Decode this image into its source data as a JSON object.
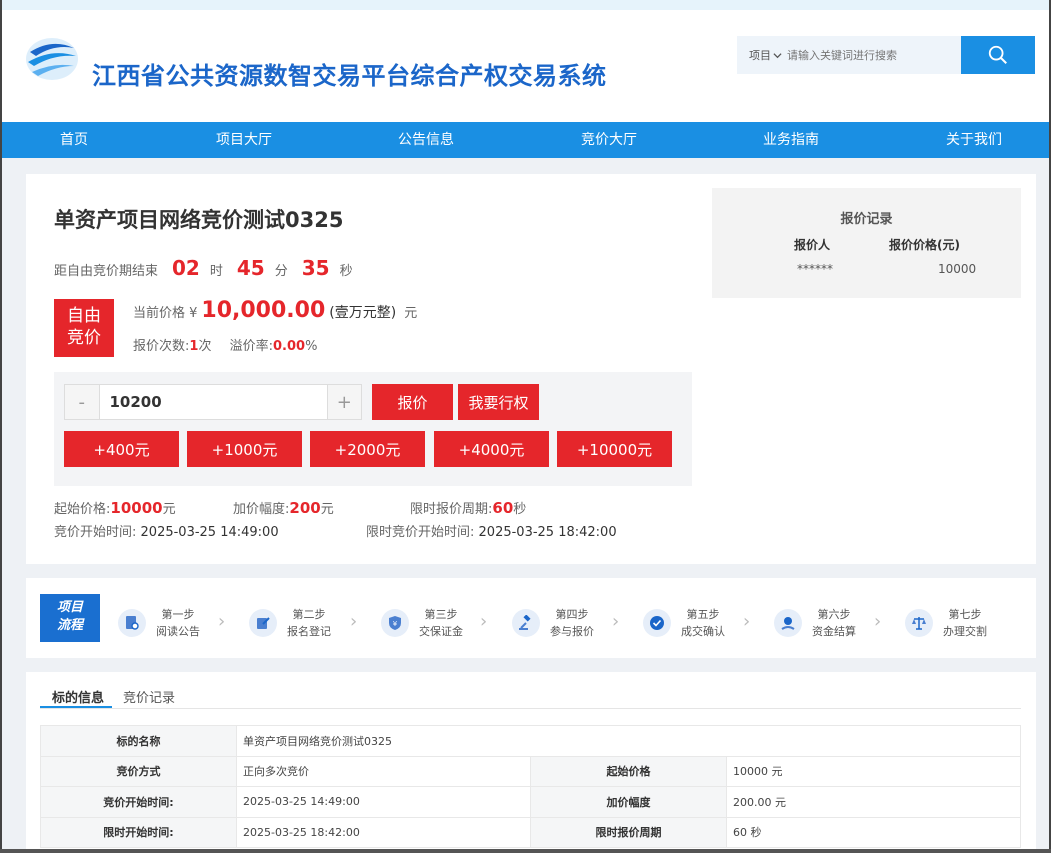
{
  "header": {
    "site_title": "江西省公共资源数智交易平台综合产权交易系统"
  },
  "search": {
    "category": "项目",
    "placeholder": "请输入关键词进行搜索"
  },
  "nav": [
    "首页",
    "项目大厅",
    "公告信息",
    "竞价大厅",
    "业务指南",
    "关于我们"
  ],
  "project": {
    "title": "单资产项目网络竞价测试0325",
    "countdown": {
      "label": "距自由竞价期结束",
      "hours": "02",
      "h_unit": "时",
      "minutes": "45",
      "m_unit": "分",
      "seconds": "35",
      "s_unit": "秒"
    },
    "mode_badge": [
      "自由",
      "竞价"
    ],
    "price": {
      "label": "当前价格 ¥",
      "value": "10,000.00",
      "words": "(壹万元整)",
      "unit": "元"
    },
    "bid_count_label": "报价次数:",
    "bid_count": "1",
    "bid_count_unit": "次",
    "premium_label": "溢价率:",
    "premium": "0.00",
    "premium_unit": "%"
  },
  "bid": {
    "minus": "-",
    "plus": "+",
    "amount": "10200",
    "submit": "报价",
    "exercise_right": "我要行权",
    "increments": [
      "+400元",
      "+1000元",
      "+2000元",
      "+4000元",
      "+10000元"
    ]
  },
  "terms": {
    "start_price_label": "起始价格:",
    "start_price": "10000",
    "start_price_unit": "元",
    "increment_label": "加价幅度:",
    "increment": "200",
    "increment_unit": "元",
    "limit_cycle_label": "限时报价周期:",
    "limit_cycle": "60",
    "limit_cycle_unit": "秒",
    "start_time_label": "竞价开始时间:",
    "start_time": "2025-03-25 14:49:00",
    "limit_start_label": "限时竞价开始时间:",
    "limit_start": "2025-03-25 18:42:00"
  },
  "records": {
    "title": "报价记录",
    "col_bidder": "报价人",
    "col_price": "报价价格(元)",
    "rows": [
      {
        "bidder": "******",
        "price": "10000"
      }
    ]
  },
  "flow": {
    "badge": [
      "项目",
      "流程"
    ],
    "steps": [
      {
        "num": "第一步",
        "name": "阅读公告",
        "icon": "document-search-icon"
      },
      {
        "num": "第二步",
        "name": "报名登记",
        "icon": "edit-icon"
      },
      {
        "num": "第三步",
        "name": "交保证金",
        "icon": "shield-yen-icon"
      },
      {
        "num": "第四步",
        "name": "参与报价",
        "icon": "gavel-icon"
      },
      {
        "num": "第五步",
        "name": "成交确认",
        "icon": "check-circle-icon"
      },
      {
        "num": "第六步",
        "name": "资金结算",
        "icon": "hand-money-icon"
      },
      {
        "num": "第七步",
        "name": "办理交割",
        "icon": "scale-icon"
      }
    ]
  },
  "detail": {
    "tabs": [
      "标的信息",
      "竞价记录"
    ],
    "rows": [
      {
        "l1": "标的名称",
        "v1": "单资产项目网络竞价测试0325"
      },
      {
        "l1": "竞价方式",
        "v1": "正向多次竞价",
        "l2": "起始价格",
        "v2": "10000 元"
      },
      {
        "l1": "竞价开始时间:",
        "v1": "2025-03-25 14:49:00",
        "l2": "加价幅度",
        "v2": "200.00 元"
      },
      {
        "l1": "限时开始时间:",
        "v1": "2025-03-25 18:42:00",
        "l2": "限时报价周期",
        "v2": "60 秒"
      }
    ]
  },
  "colors": {
    "brand_blue": "#1a8fe3",
    "accent_red": "#e5262b",
    "title_blue": "#1b66c9"
  }
}
